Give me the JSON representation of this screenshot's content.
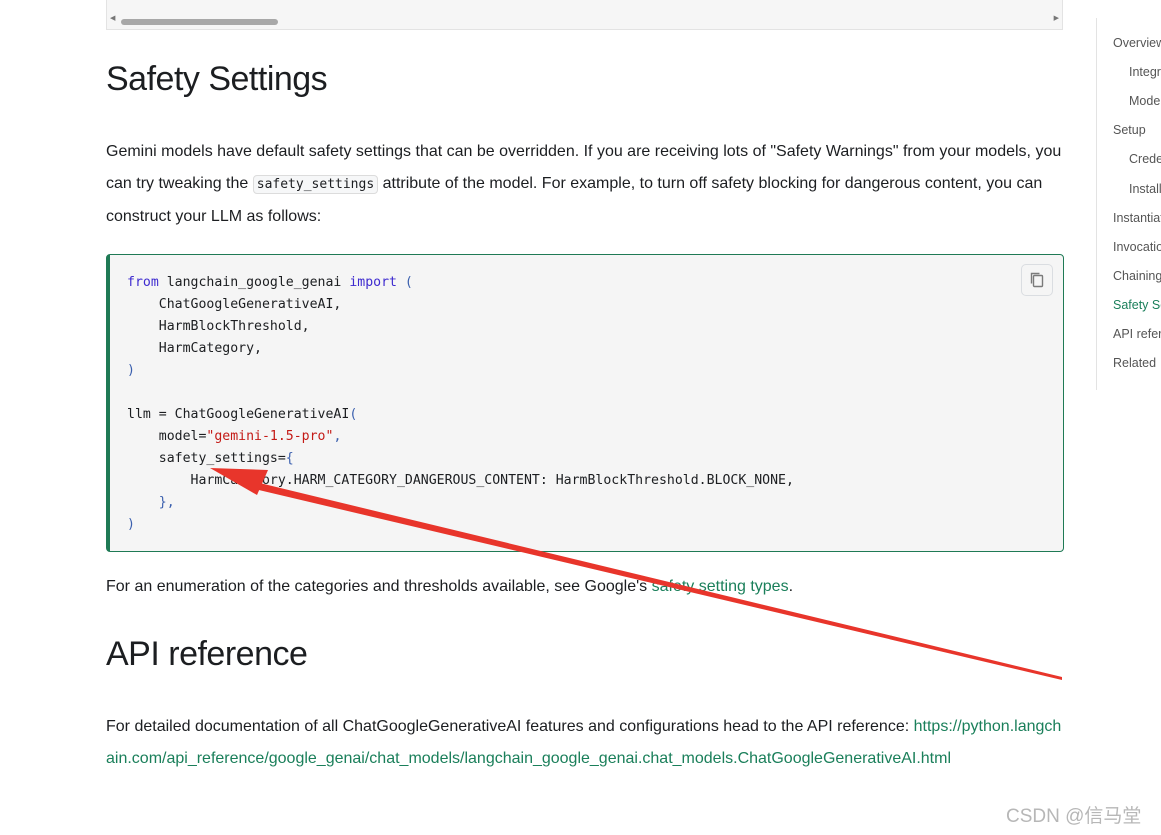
{
  "safety_section": {
    "heading": "Safety Settings",
    "para1_part1": "Gemini models have default safety settings that can be overridden. If you are receiving lots of \"Safety Warnings\" from your models, you can try tweaking the ",
    "para1_code": "safety_settings",
    "para1_part2": " attribute of the model. For example, to turn off safety blocking for dangerous content, you can construct your LLM as follows:",
    "code_lines": {
      "l1_kw1": "from",
      "l1_mid": " langchain_google_genai ",
      "l1_kw2": "import",
      "l1_paren": " (",
      "l2": "    ChatGoogleGenerativeAI,",
      "l3": "    HarmBlockThreshold,",
      "l4": "    HarmCategory,",
      "l5": ")",
      "l7_a": "llm = ChatGoogleGenerativeAI",
      "l7_b": "(",
      "l8_a": "    model=",
      "l8_str": "\"gemini-1.5-pro\"",
      "l8_b": ",",
      "l9_a": "    safety_settings=",
      "l9_b": "{",
      "l10": "        HarmCategory.HARM_CATEGORY_DANGEROUS_CONTENT: HarmBlockThreshold.BLOCK_NONE,",
      "l11": "    },",
      "l12": ")"
    },
    "para2_part1": "For an enumeration of the categories and thresholds available, see Google's ",
    "para2_link": "safety setting types",
    "para2_part2": "."
  },
  "api_section": {
    "heading": "API reference",
    "para_text": "For detailed documentation of all ChatGoogleGenerativeAI features and configurations head to the API reference: ",
    "link": "https://python.langchain.com/api_reference/google_genai/chat_models/langchain_google_genai.chat_models.ChatGoogleGenerativeAI.html"
  },
  "toc": {
    "items": [
      {
        "label": "Overview"
      },
      {
        "label": "Integration details"
      },
      {
        "label": "Model features"
      },
      {
        "label": "Setup"
      },
      {
        "label": "Credentials"
      },
      {
        "label": "Installation"
      },
      {
        "label": "Instantiation"
      },
      {
        "label": "Invocation"
      },
      {
        "label": "Chaining"
      },
      {
        "label": "Safety Settings"
      },
      {
        "label": "API reference"
      },
      {
        "label": "Related"
      }
    ]
  },
  "watermark": "CSDN @信马堂",
  "colors": {
    "accent": "#1a7f5a",
    "arrow": "#e8352b",
    "code_border": "#1f7a55"
  },
  "icons": {
    "copy": "copy-icon"
  }
}
